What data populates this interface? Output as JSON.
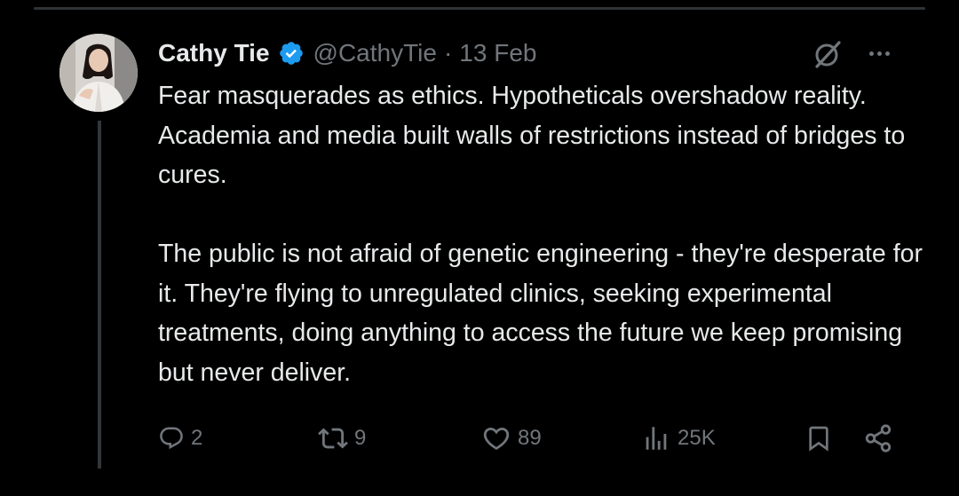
{
  "author": {
    "display_name": "Cathy Tie",
    "handle": "@CathyTie",
    "separator": "·",
    "time": "13 Feb",
    "verified": true
  },
  "tweet": {
    "paragraphs": [
      "Fear masquerades as ethics. Hypotheticals overshadow reality. Academia and media built walls of restrictions instead of bridges to cures.",
      "The public is not afraid of genetic engineering - they're desperate for it. They're flying to unregulated clinics, seeking experimental treatments, doing anything to access the future we keep promising but never deliver."
    ]
  },
  "actions": {
    "replies": "2",
    "reposts": "9",
    "likes": "89",
    "views": "25K"
  },
  "icons": {
    "verified": "verified-badge-icon",
    "grok": "grok-icon",
    "more": "more-icon",
    "reply": "reply-icon",
    "repost": "repost-icon",
    "like": "like-icon",
    "views": "views-icon",
    "bookmark": "bookmark-icon",
    "share": "share-icon"
  },
  "colors": {
    "background": "#000000",
    "text": "#e7e9ea",
    "muted": "#71767b",
    "verified_blue": "#1d9bf0"
  }
}
